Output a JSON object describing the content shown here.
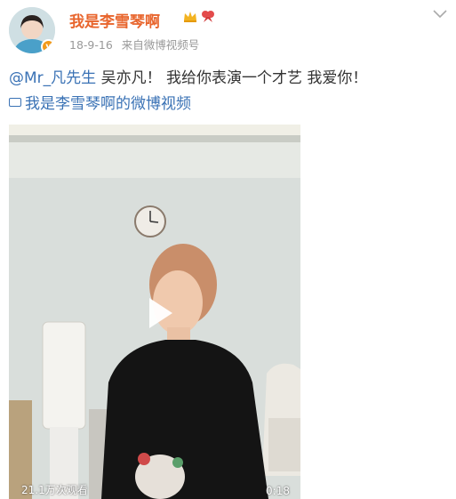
{
  "post": {
    "username": "我是李雪琴啊",
    "date": "18-9-16",
    "source": "来自微博视频号",
    "mention": "@Mr_凡先生",
    "text": " 吴亦凡！ 我给你表演一个才艺 我爱你！",
    "video_link": "我是李雪琴啊的微博视频"
  },
  "video": {
    "views": "21.1万次观看",
    "duration": "0:18"
  },
  "colors": {
    "username": "#e8652d",
    "link": "#3a72b5",
    "meta": "#999999"
  },
  "icons": [
    "avatar",
    "verified-icon",
    "crown-icon",
    "ribbon-icon",
    "chevron-down-icon",
    "video-icon",
    "play-icon"
  ]
}
